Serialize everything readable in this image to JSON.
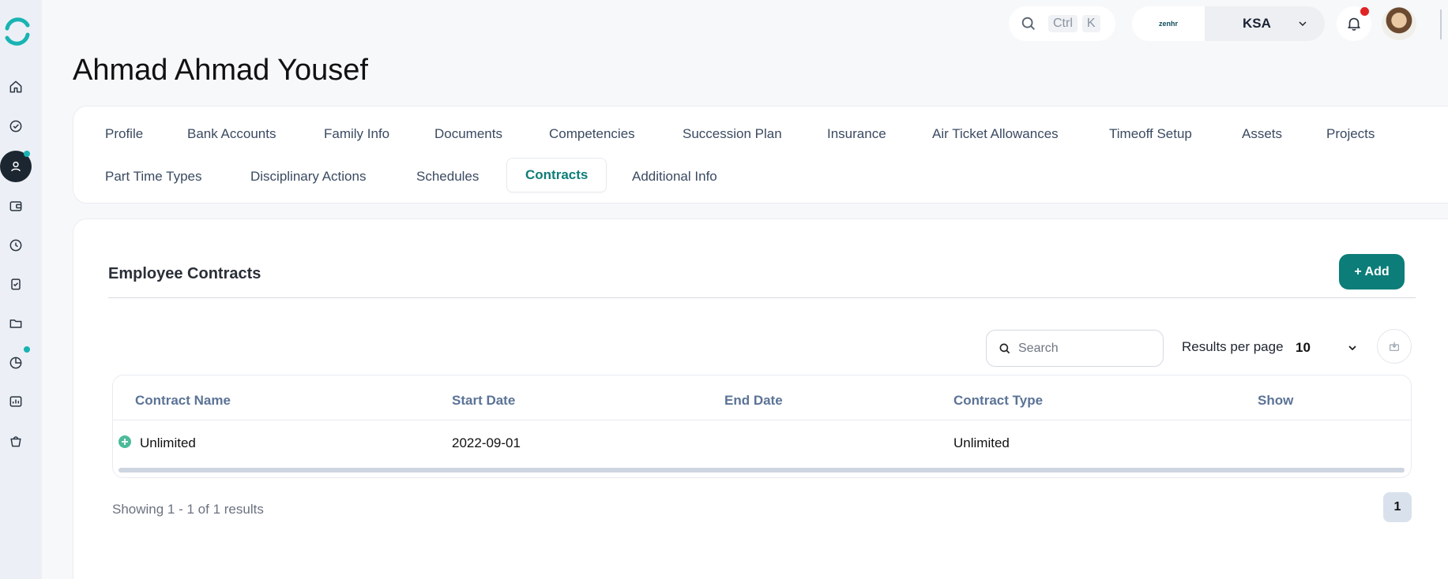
{
  "header": {
    "search_shortcut_ctrl": "Ctrl",
    "search_shortcut_key": "K",
    "company_logo_text": "zenhr",
    "country": "KSA"
  },
  "page": {
    "title": "Ahmad Ahmad Yousef"
  },
  "tabs": [
    {
      "label": "Profile"
    },
    {
      "label": "Bank Accounts"
    },
    {
      "label": "Family Info"
    },
    {
      "label": "Documents"
    },
    {
      "label": "Competencies"
    },
    {
      "label": "Succession Plan"
    },
    {
      "label": "Insurance"
    },
    {
      "label": "Air Ticket Allowances"
    },
    {
      "label": "Timeoff Setup"
    },
    {
      "label": "Assets"
    },
    {
      "label": "Projects"
    },
    {
      "label": "Part Time Types"
    },
    {
      "label": "Disciplinary Actions"
    },
    {
      "label": "Schedules"
    },
    {
      "label": "Contracts"
    },
    {
      "label": "Additional Info"
    }
  ],
  "active_tab": "Contracts",
  "section": {
    "title": "Employee Contracts",
    "add_label": "+ Add"
  },
  "table_controls": {
    "search_placeholder": "Search",
    "results_per_page_label": "Results per page",
    "results_per_page_value": "10"
  },
  "table": {
    "columns": [
      "Contract Name",
      "Start Date",
      "End Date",
      "Contract Type",
      "Show"
    ],
    "rows": [
      {
        "contract_name": "Unlimited",
        "start_date": "2022-09-01",
        "end_date": "",
        "contract_type": "Unlimited",
        "show": ""
      }
    ]
  },
  "pagination": {
    "summary": "Showing 1 - 1 of 1 results",
    "current_page": "1"
  },
  "colors": {
    "accent": "#0c7d78",
    "sidebar_bg": "#ecf0f6",
    "active_nav_bg": "#1b2631",
    "notification_dot": "#e02424",
    "sidebar_dot": "#19b3b3"
  },
  "sidebar_icons": [
    "home-icon",
    "check-circle-icon",
    "user-icon",
    "wallet-icon",
    "clock-icon",
    "clipboard-check-icon",
    "folder-icon",
    "pie-chart-icon",
    "bar-chart-icon",
    "shopping-bag-icon"
  ]
}
